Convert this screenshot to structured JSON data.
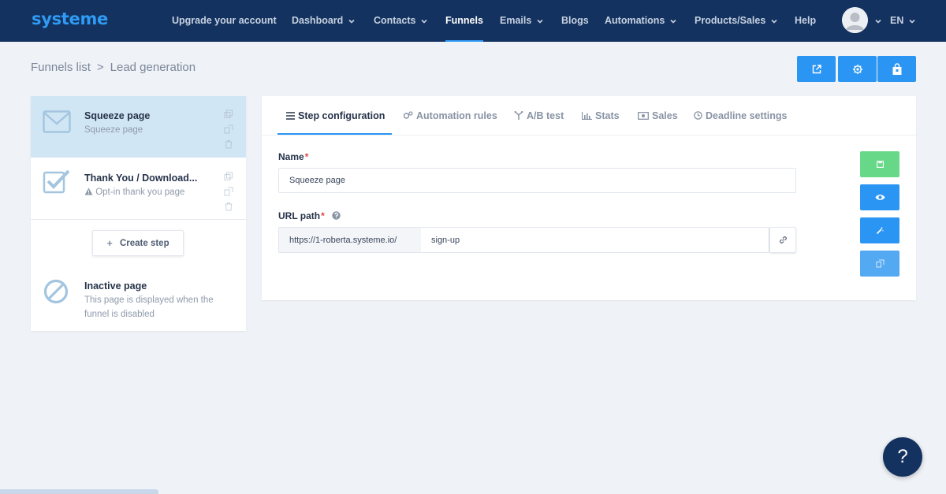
{
  "brand": {
    "logo_text": "systeme",
    "accent_color": "#2f9bf4",
    "nav_bg": "#14325f"
  },
  "nav": {
    "items": [
      {
        "label": "Upgrade your account",
        "has_dropdown": false
      },
      {
        "label": "Dashboard",
        "has_dropdown": true
      },
      {
        "label": "Contacts",
        "has_dropdown": true
      },
      {
        "label": "Funnels",
        "has_dropdown": false,
        "active": true
      },
      {
        "label": "Emails",
        "has_dropdown": true
      },
      {
        "label": "Blogs",
        "has_dropdown": false
      },
      {
        "label": "Automations",
        "has_dropdown": true
      },
      {
        "label": "Products/Sales",
        "has_dropdown": true
      },
      {
        "label": "Help",
        "has_dropdown": false
      }
    ],
    "language": "EN"
  },
  "breadcrumb": {
    "parent": "Funnels list",
    "separator": ">",
    "current": "Lead generation"
  },
  "toolbar": {
    "icons": [
      "external-link-icon",
      "gear-icon",
      "shopping-bag-icon"
    ]
  },
  "steps": [
    {
      "title": "Squeeze page",
      "subtitle": "Squeeze page",
      "icon": "envelope-icon",
      "selected": true
    },
    {
      "title": "Thank You / Download...",
      "subtitle": "Opt-in thank you page",
      "icon": "checkbox-icon",
      "warning": true
    }
  ],
  "create_step": {
    "label": "Create step"
  },
  "inactive_page": {
    "title": "Inactive page",
    "description_line1": "This page is displayed when the",
    "description_line2": "funnel is disabled"
  },
  "tabs": [
    {
      "label": "Step configuration",
      "icon": "list-icon",
      "active": true
    },
    {
      "label": "Automation rules",
      "icon": "gears-icon"
    },
    {
      "label": "A/B test",
      "icon": "split-icon"
    },
    {
      "label": "Stats",
      "icon": "bar-chart-icon"
    },
    {
      "label": "Sales",
      "icon": "money-icon"
    },
    {
      "label": "Deadline settings",
      "icon": "clock-icon"
    }
  ],
  "form": {
    "name_label": "Name",
    "name_value": "Squeeze page",
    "required_mark": "*",
    "url_label": "URL path",
    "url_prefix": "https://1-roberta.systeme.io/",
    "url_value": "sign-up"
  },
  "side_actions": [
    {
      "icon": "save-icon",
      "color": "#67d887"
    },
    {
      "icon": "eye-icon",
      "color": "#2b95f3"
    },
    {
      "icon": "magic-wand-icon",
      "color": "#2b95f3"
    },
    {
      "icon": "duplicate-icon",
      "color": "#53a9f2"
    }
  ],
  "help": {
    "label": "?"
  }
}
